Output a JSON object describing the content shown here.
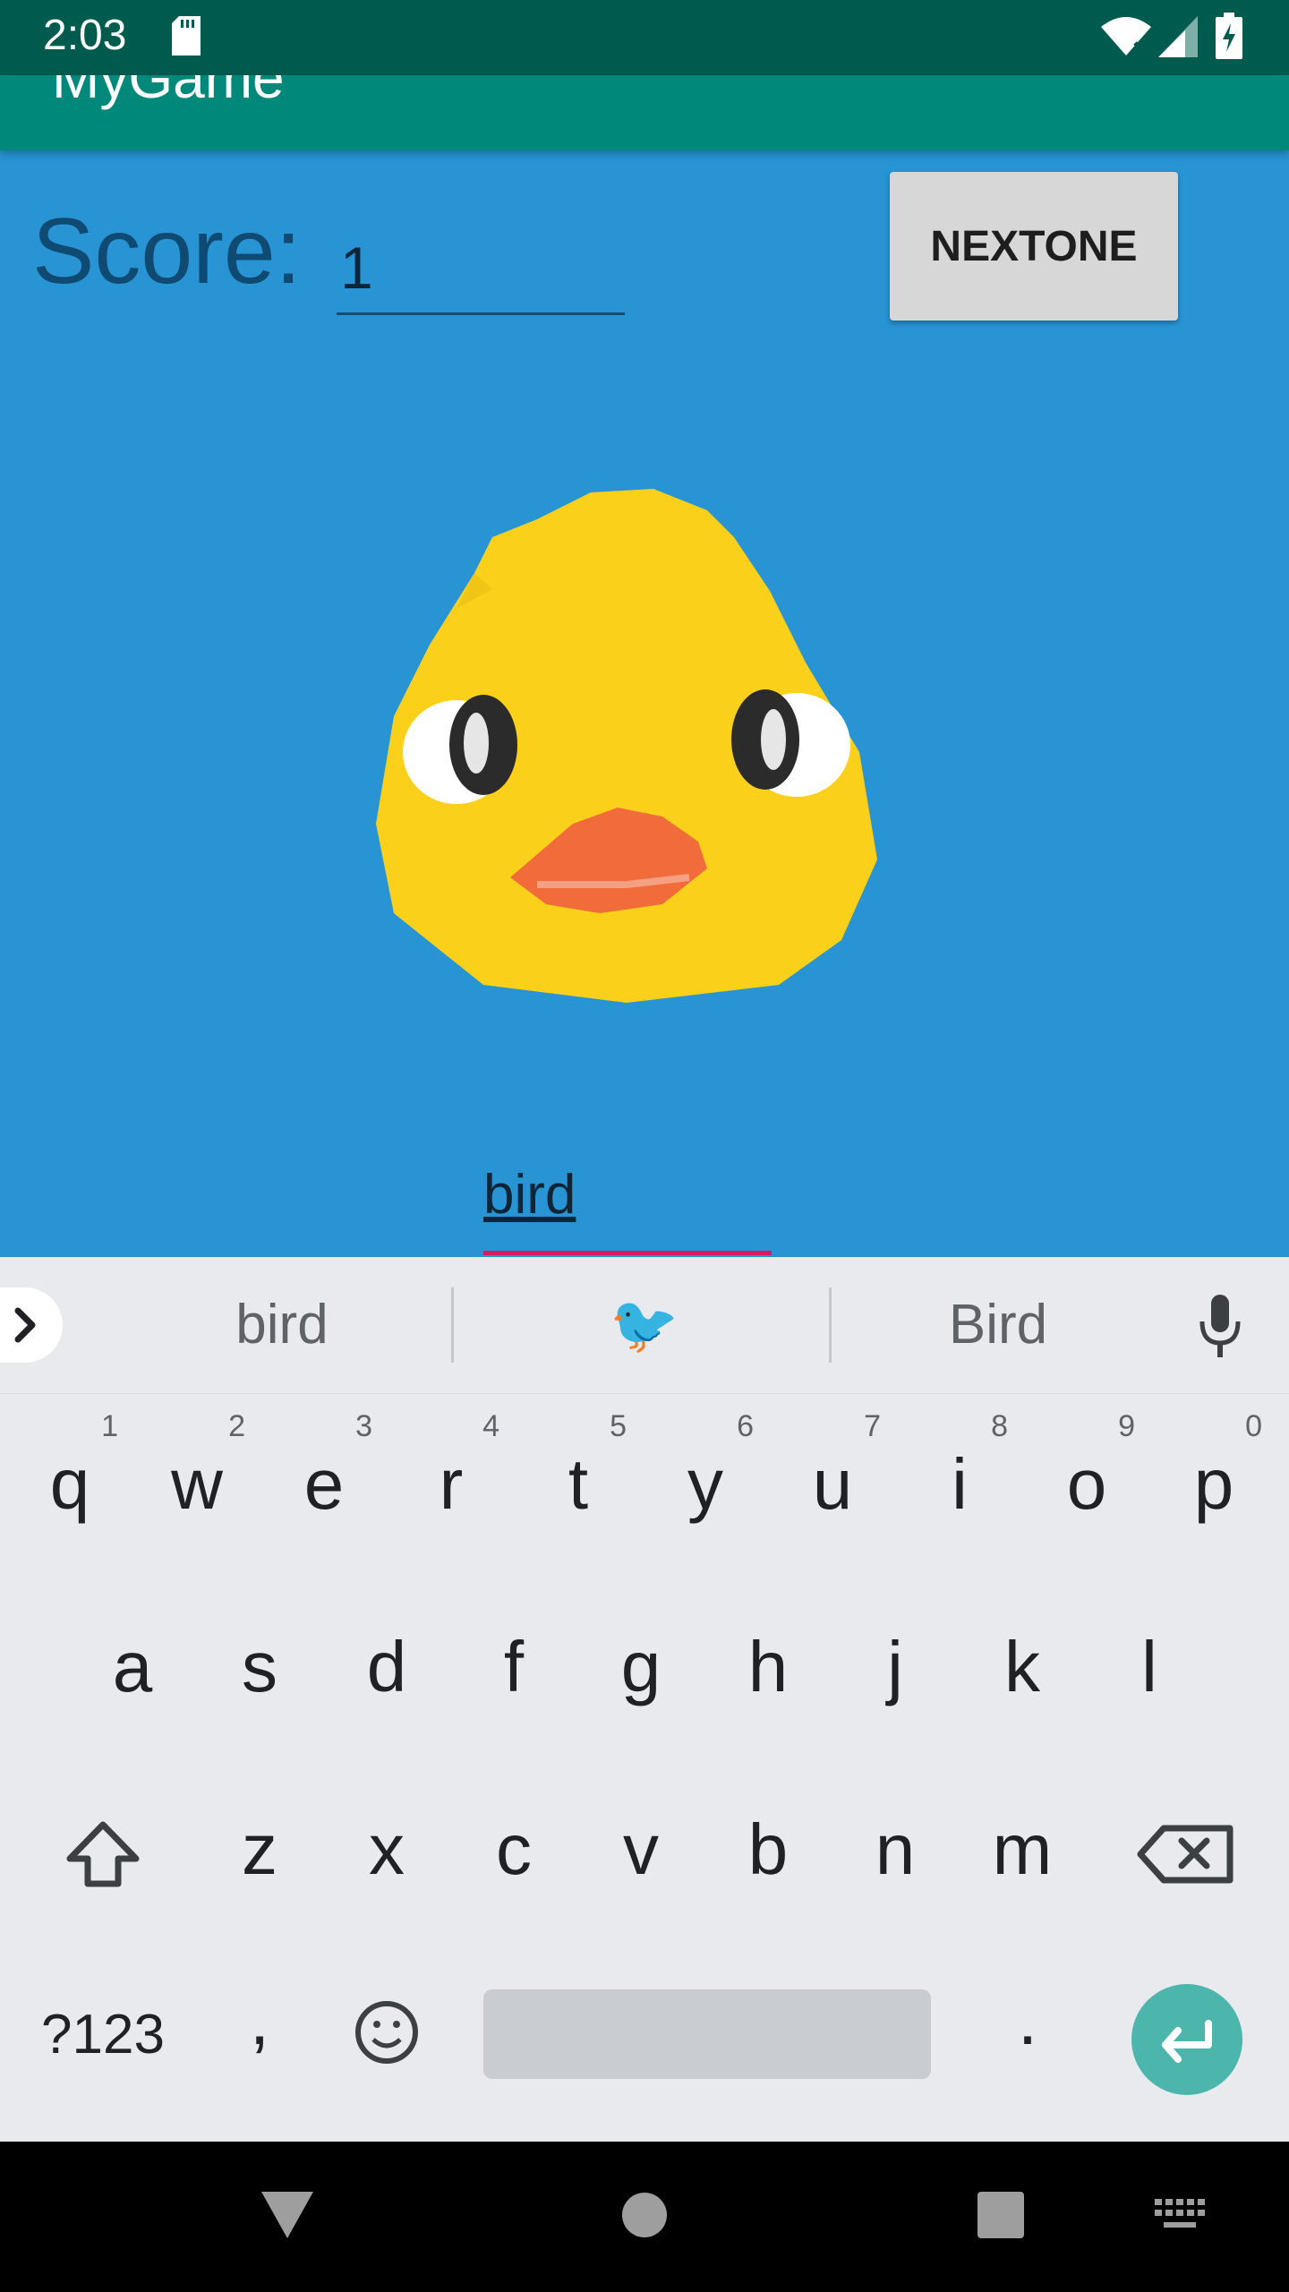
{
  "status_bar": {
    "time": "2:03"
  },
  "app_bar": {
    "title": "MyGame"
  },
  "score": {
    "label": "Score:",
    "value": "1"
  },
  "next_button": {
    "label": "NEXTONE"
  },
  "answer": {
    "value": "bird"
  },
  "keyboard": {
    "suggestions": [
      "bird",
      "🐦",
      "Bird"
    ],
    "row1": [
      {
        "k": "q",
        "h": "1"
      },
      {
        "k": "w",
        "h": "2"
      },
      {
        "k": "e",
        "h": "3"
      },
      {
        "k": "r",
        "h": "4"
      },
      {
        "k": "t",
        "h": "5"
      },
      {
        "k": "y",
        "h": "6"
      },
      {
        "k": "u",
        "h": "7"
      },
      {
        "k": "i",
        "h": "8"
      },
      {
        "k": "o",
        "h": "9"
      },
      {
        "k": "p",
        "h": "0"
      }
    ],
    "row2": [
      "a",
      "s",
      "d",
      "f",
      "g",
      "h",
      "j",
      "k",
      "l"
    ],
    "row3": [
      "z",
      "x",
      "c",
      "v",
      "b",
      "n",
      "m"
    ],
    "symbols_label": "?123",
    "comma_label": ",",
    "period_label": "."
  },
  "colors": {
    "accent": "#00897b",
    "status_bar": "#005b4f",
    "background": "#2894d4",
    "underline": "#d81b60",
    "enter": "#4db6ac"
  }
}
